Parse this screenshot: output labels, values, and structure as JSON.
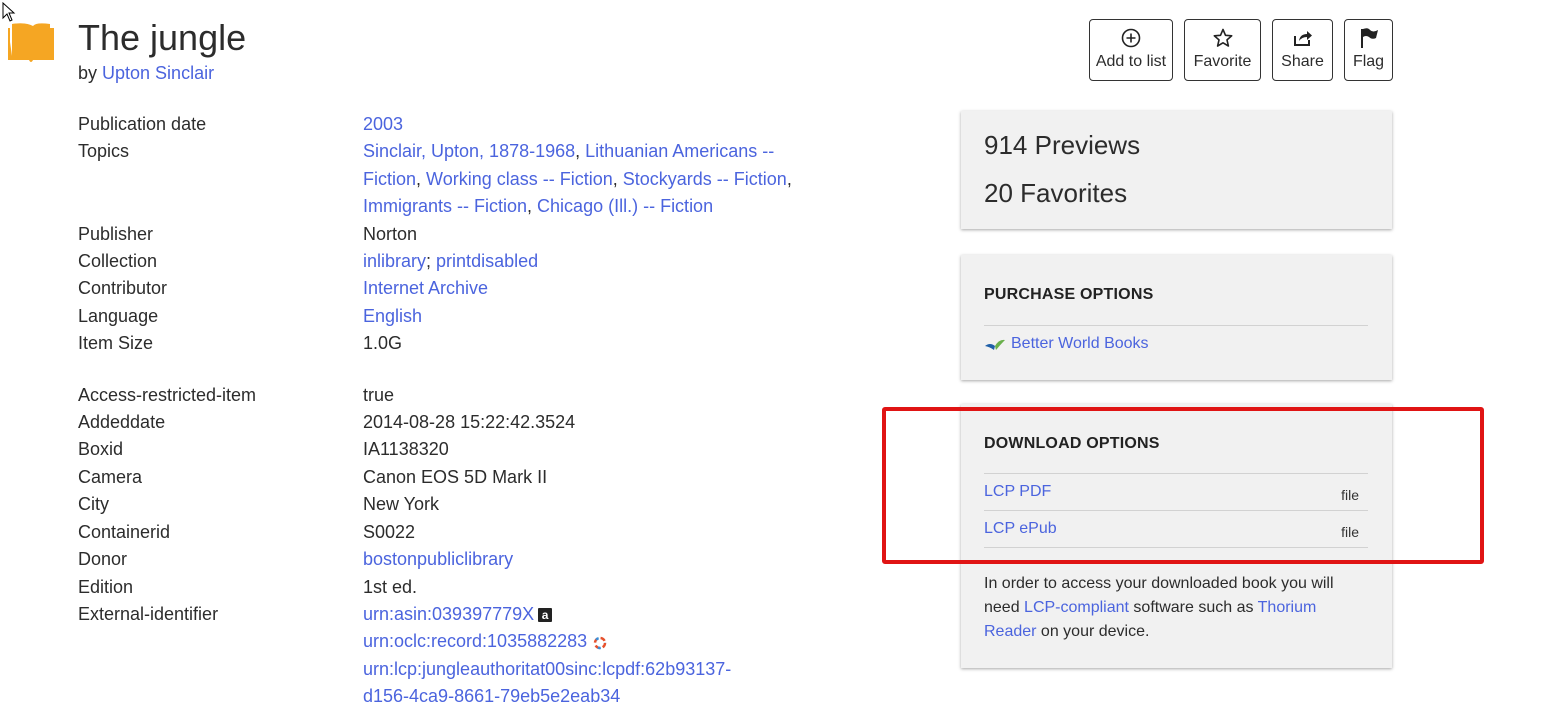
{
  "header": {
    "title": "The jungle",
    "by_label": "by",
    "author": "Upton Sinclair"
  },
  "actions": [
    {
      "label": "Add to list",
      "icon": "plus-circle-icon"
    },
    {
      "label": "Favorite",
      "icon": "star-icon"
    },
    {
      "label": "Share",
      "icon": "share-icon"
    },
    {
      "label": "Flag",
      "icon": "flag-icon"
    }
  ],
  "metadata": {
    "publication_date": {
      "key": "Publication date",
      "value": "2003"
    },
    "topics": {
      "key": "Topics",
      "items": [
        "Sinclair, Upton, 1878-1968",
        "Lithuanian Americans -- Fiction",
        "Working class -- Fiction",
        "Stockyards -- Fiction",
        "Immigrants -- Fiction",
        "Chicago (Ill.) -- Fiction"
      ]
    },
    "publisher": {
      "key": "Publisher",
      "value": "Norton"
    },
    "collection": {
      "key": "Collection",
      "items": [
        "inlibrary",
        "printdisabled"
      ]
    },
    "contributor": {
      "key": "Contributor",
      "value": "Internet Archive"
    },
    "language": {
      "key": "Language",
      "value": "English"
    },
    "item_size": {
      "key": "Item Size",
      "value": "1.0G"
    },
    "access_restricted": {
      "key": "Access-restricted-item",
      "value": "true"
    },
    "addeddate": {
      "key": "Addeddate",
      "value": "2014-08-28 15:22:42.3524"
    },
    "boxid": {
      "key": "Boxid",
      "value": "IA1138320"
    },
    "camera": {
      "key": "Camera",
      "value": "Canon EOS 5D Mark II"
    },
    "city": {
      "key": "City",
      "value": "New York"
    },
    "containerid": {
      "key": "Containerid",
      "value": "S0022"
    },
    "donor": {
      "key": "Donor",
      "value": "bostonpubliclibrary"
    },
    "edition": {
      "key": "Edition",
      "value": "1st ed."
    },
    "external_identifier": {
      "key": "External-identifier",
      "items": [
        "urn:asin:039397779X",
        "urn:oclc:record:1035882283",
        "urn:lcp:jungleauthoritat00sinc:lcpdf:62b93137-",
        "d156-4ca9-8661-79eb5e2eab34"
      ]
    }
  },
  "stats": {
    "previews": "914 Previews",
    "favorites": "20 Favorites"
  },
  "purchase": {
    "heading": "PURCHASE OPTIONS",
    "link": "Better World Books"
  },
  "download": {
    "heading": "DOWNLOAD OPTIONS",
    "options": [
      {
        "label": "LCP PDF",
        "type": "file"
      },
      {
        "label": "LCP ePub",
        "type": "file"
      }
    ],
    "note_1": "In order to access your downloaded book you will need ",
    "note_link_1": "LCP-compliant",
    "note_2": " software such as ",
    "note_link_2": "Thorium Reader",
    "note_3": " on your device."
  },
  "colors": {
    "link": "#4b64de",
    "highlight": "#e01414",
    "panel_bg": "#f1f1f1",
    "book_icon": "#f5a623"
  }
}
